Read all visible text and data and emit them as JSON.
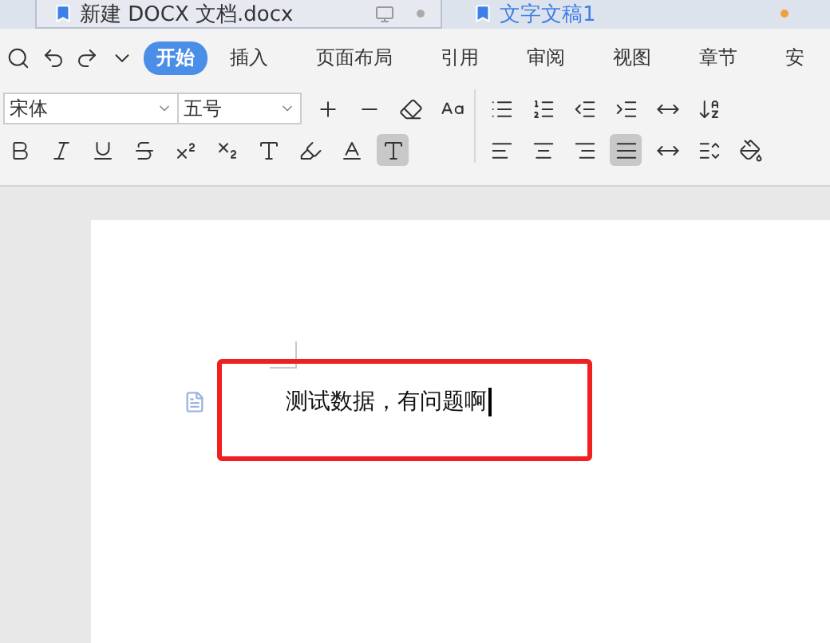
{
  "doc_tabs": [
    {
      "title": "新建 DOCX 文档.docx",
      "selected": true
    },
    {
      "title": "文字文稿1",
      "selected": false
    }
  ],
  "menu": [
    {
      "label": "开始",
      "selected": true
    },
    {
      "label": "插入",
      "selected": false
    },
    {
      "label": "页面布局",
      "selected": false
    },
    {
      "label": "引用",
      "selected": false
    },
    {
      "label": "审阅",
      "selected": false
    },
    {
      "label": "视图",
      "selected": false
    },
    {
      "label": "章节",
      "selected": false
    },
    {
      "label": "安",
      "selected": false
    }
  ],
  "font": {
    "name": "宋体",
    "size": "五号"
  },
  "align_buttons": [
    {
      "selected": false
    },
    {
      "selected": false
    },
    {
      "selected": false
    },
    {
      "selected": true
    }
  ],
  "document": {
    "text": "测试数据，有问题啊",
    "highlighted": true
  }
}
